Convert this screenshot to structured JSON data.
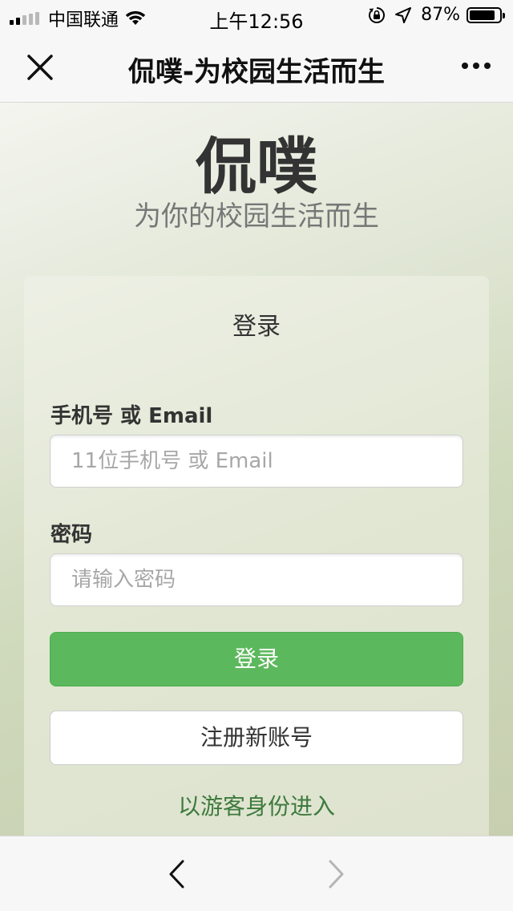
{
  "status_bar": {
    "carrier": "中国联通",
    "time": "上午12:56",
    "battery_percent": "87%",
    "battery_level": 0.87,
    "signal_bars_filled": 2,
    "signal_bars_total": 5,
    "icons": [
      "signal-icon",
      "wifi-icon",
      "orientation-lock-icon",
      "location-icon",
      "battery-icon"
    ]
  },
  "nav": {
    "title": "侃噗-为校园生活而生",
    "icons": [
      "close-icon",
      "more-icon"
    ]
  },
  "header": {
    "brand": "侃噗",
    "slogan": "为你的校园生活而生"
  },
  "login_form": {
    "title": "登录",
    "account_label": "手机号 或 Email",
    "account_placeholder": "11位手机号 或 Email",
    "account_value": "",
    "password_label": "密码",
    "password_placeholder": "请输入密码",
    "password_value": "",
    "login_button": "登录",
    "register_button": "注册新账号",
    "guest_link": "以游客身份进入"
  },
  "toolbar": {
    "icons": [
      "back-icon",
      "forward-icon"
    ]
  },
  "colors": {
    "primary_button": "#5cb85c",
    "link": "#3d7a3d",
    "forward_disabled": "#b5b5b5"
  }
}
